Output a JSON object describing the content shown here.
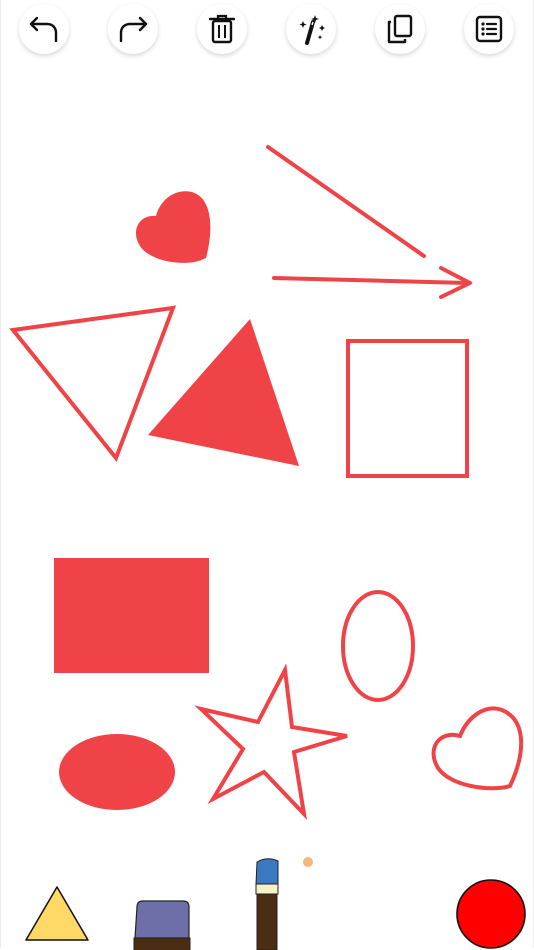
{
  "app": {
    "title": ""
  },
  "toolbar": {
    "buttons": [
      {
        "id": "undo",
        "icon": "undo-icon"
      },
      {
        "id": "redo",
        "icon": "redo-icon"
      },
      {
        "id": "delete",
        "icon": "trash-icon"
      },
      {
        "id": "magic",
        "icon": "magic-wand-icon"
      },
      {
        "id": "copy",
        "icon": "copy-icon"
      },
      {
        "id": "list",
        "icon": "list-icon"
      }
    ]
  },
  "canvas": {
    "stroke_color": "#F04347",
    "shapes": [
      {
        "kind": "heart",
        "style": "filled"
      },
      {
        "kind": "line",
        "style": "stroke"
      },
      {
        "kind": "arrow",
        "style": "stroke"
      },
      {
        "kind": "triangle",
        "style": "outline"
      },
      {
        "kind": "triangle",
        "style": "filled"
      },
      {
        "kind": "square",
        "style": "outline"
      },
      {
        "kind": "rectangle",
        "style": "filled"
      },
      {
        "kind": "ellipse",
        "style": "outline"
      },
      {
        "kind": "star",
        "style": "outline"
      },
      {
        "kind": "heart",
        "style": "outline"
      },
      {
        "kind": "ellipse",
        "style": "filled"
      }
    ]
  },
  "bottom_tools": {
    "shape_tool": {
      "icon": "triangle-shape-icon",
      "color": "#FFD966"
    },
    "eraser_tool": {
      "icon": "eraser-icon",
      "color": "#6E6FA8"
    },
    "brush_tool": {
      "icon": "paintbrush-icon",
      "color": "#3A79C0"
    },
    "brush_size_dot_color": "#F5B87A",
    "color_picker": {
      "icon": "color-swatch-icon",
      "color": "#FF0000"
    }
  }
}
